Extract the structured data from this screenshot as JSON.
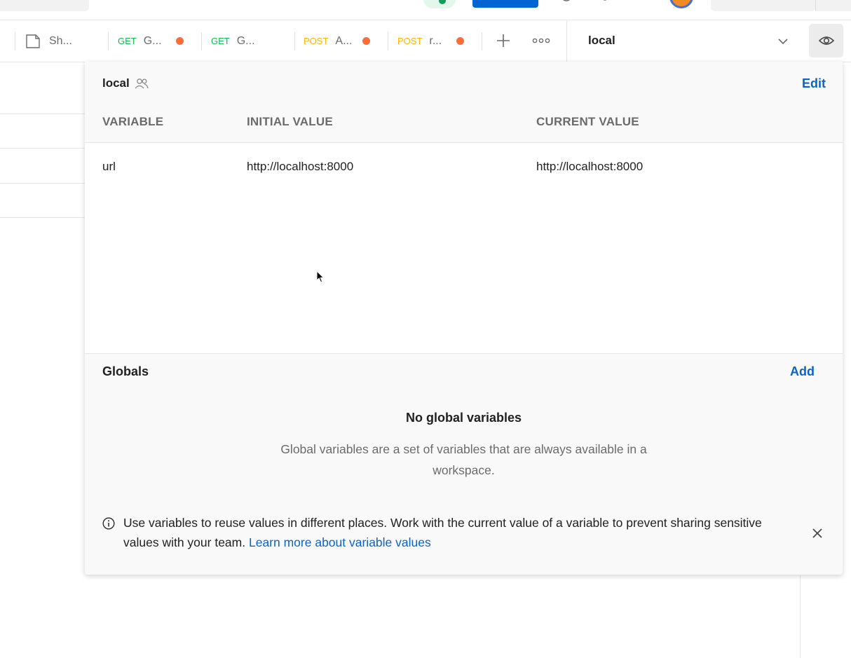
{
  "tabs": [
    {
      "method": "",
      "label": "Sh...",
      "icon": "document-icon",
      "unsaved": false
    },
    {
      "method": "GET",
      "label": "G...",
      "unsaved": true
    },
    {
      "method": "GET",
      "label": "G...",
      "unsaved": false
    },
    {
      "method": "POST",
      "label": "A...",
      "unsaved": true
    },
    {
      "method": "POST",
      "label": "r...",
      "unsaved": true
    }
  ],
  "environment_selector": {
    "selected": "local"
  },
  "popover": {
    "env_name": "local",
    "edit_label": "Edit",
    "columns": {
      "variable": "VARIABLE",
      "initial": "INITIAL VALUE",
      "current": "CURRENT VALUE"
    },
    "variables": [
      {
        "name": "url",
        "initial": "http://localhost:8000",
        "current": "http://localhost:8000"
      }
    ],
    "globals_title": "Globals",
    "add_label": "Add",
    "empty_title": "No global variables",
    "empty_text": "Global variables are a set of variables that are always available in a workspace.",
    "info_text": "Use variables to reuse values in different places. Work with the current value of a variable to prevent sharing sensitive values with your team.",
    "info_link": "Learn more about variable values"
  },
  "colors": {
    "accent_blue": "#0265d2",
    "link": "#0b63c9",
    "get": "#0cbb52",
    "post": "#ffb400",
    "unsaved_dot": "#ff6c37"
  }
}
